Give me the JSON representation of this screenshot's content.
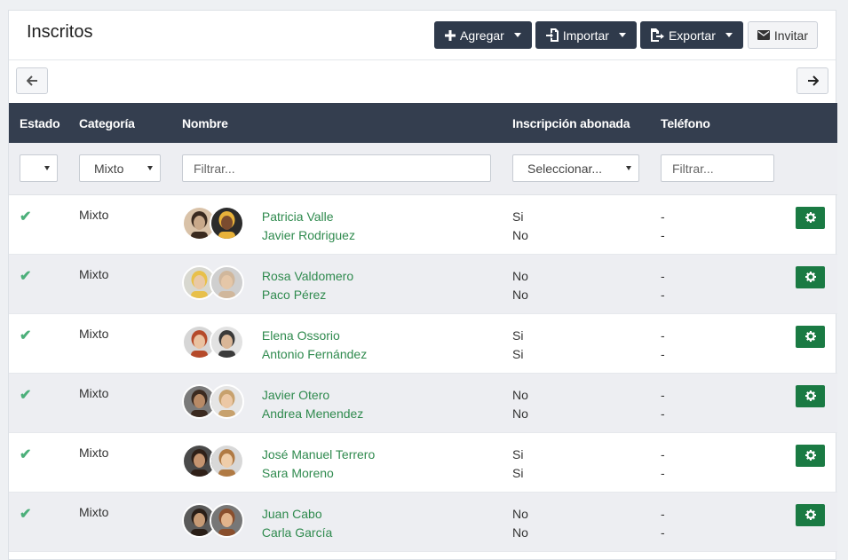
{
  "header": {
    "title": "Inscritos",
    "buttons": {
      "agregar": "Agregar",
      "importar": "Importar",
      "exportar": "Exportar",
      "invitar": "Invitar"
    }
  },
  "table": {
    "columns": [
      "Estado",
      "Categoría",
      "Nombre",
      "Inscripción abonada",
      "Teléfono"
    ],
    "filters": {
      "categoria": "Mixto",
      "nombre_placeholder": "Filtrar...",
      "inscripcion": "Seleccionar...",
      "telefono_placeholder": "Filtrar..."
    },
    "rows": [
      {
        "categoria": "Mixto",
        "p1": "Patricia Valle",
        "p2": "Javier Rodriguez",
        "a1": "Si",
        "a2": "No",
        "t1": "-",
        "t2": "-"
      },
      {
        "categoria": "Mixto",
        "p1": "Rosa Valdomero",
        "p2": "Paco Pérez",
        "a1": "No",
        "a2": "No",
        "t1": "-",
        "t2": "-"
      },
      {
        "categoria": "Mixto",
        "p1": "Elena Ossorio",
        "p2": "Antonio Fernández",
        "a1": "Si",
        "a2": "Si",
        "t1": "-",
        "t2": "-"
      },
      {
        "categoria": "Mixto",
        "p1": "Javier Otero",
        "p2": "Andrea Menendez",
        "a1": "No",
        "a2": "No",
        "t1": "-",
        "t2": "-"
      },
      {
        "categoria": "Mixto",
        "p1": "José Manuel Terrero",
        "p2": "Sara Moreno",
        "a1": "Si",
        "a2": "Si",
        "t1": "-",
        "t2": "-"
      },
      {
        "categoria": "Mixto",
        "p1": "Juan Cabo",
        "p2": "Carla García",
        "a1": "No",
        "a2": "No",
        "t1": "-",
        "t2": "-"
      }
    ]
  },
  "colors": {
    "header_dark": "#343e4f",
    "accent_green": "#1a7a43",
    "link_green": "#2f8a4e"
  }
}
